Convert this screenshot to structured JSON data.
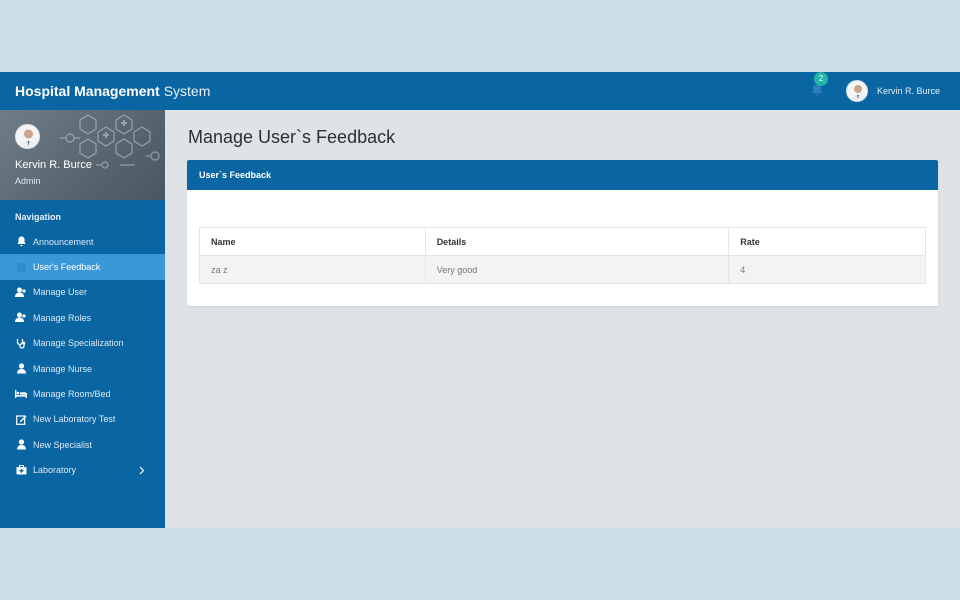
{
  "brand": {
    "bold": "Hospital Management",
    "light": "System"
  },
  "header": {
    "notification_count": "2",
    "user_name": "Kervin R. Burce"
  },
  "profile": {
    "name": "Kervin R. Burce",
    "role": "Admin"
  },
  "sidebar": {
    "nav_title": "Navigation",
    "items": [
      {
        "label": "Announcement",
        "icon": "bell-icon"
      },
      {
        "label": "User's Feedback",
        "icon": "feedback-icon",
        "active": true
      },
      {
        "label": "Manage User",
        "icon": "user-plus-icon"
      },
      {
        "label": "Manage Roles",
        "icon": "user-plus-icon"
      },
      {
        "label": "Manage Specialization",
        "icon": "stethoscope-icon"
      },
      {
        "label": "Manage Nurse",
        "icon": "user-icon"
      },
      {
        "label": "Manage Room/Bed",
        "icon": "bed-icon"
      },
      {
        "label": "New Laboratory Test",
        "icon": "edit-icon"
      },
      {
        "label": "New Specialist",
        "icon": "user-icon"
      },
      {
        "label": "Laboratory",
        "icon": "medkit-icon",
        "has_submenu": true
      }
    ]
  },
  "main": {
    "title": "Manage User`s Feedback",
    "panel_title": "User`s Feedback",
    "table": {
      "headers": [
        "Name",
        "Details",
        "Rate"
      ],
      "rows": [
        [
          "za z",
          "Very good",
          "4"
        ]
      ]
    }
  },
  "colors": {
    "primary": "#0a65a3",
    "active": "#3a97d8",
    "badge": "#1fb5a8",
    "content_bg": "#dfe3e7"
  }
}
